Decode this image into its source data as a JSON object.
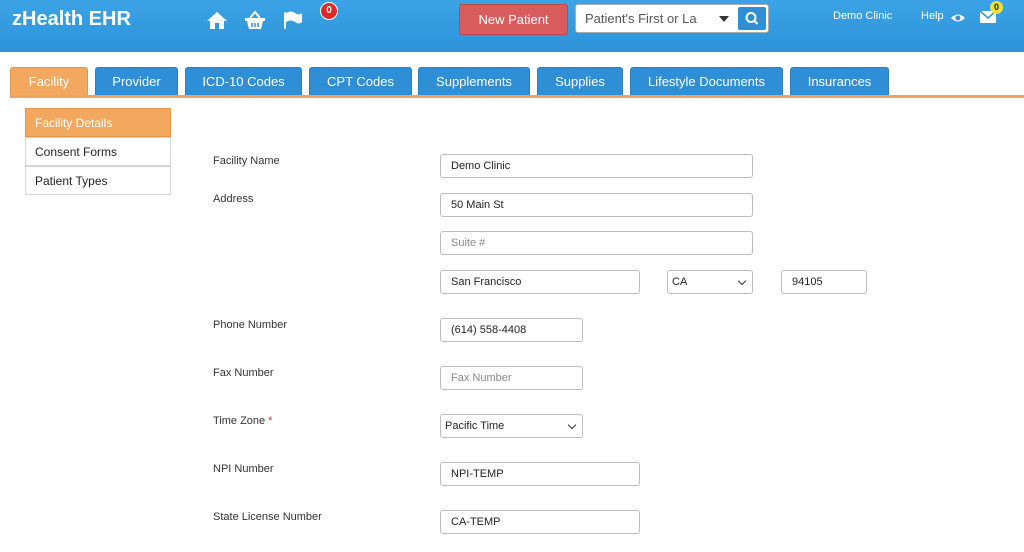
{
  "app": {
    "brand": "zHealth EHR",
    "notification_count": "0",
    "new_patient_label": "New Patient",
    "search_placeholder": "Patient's First or La",
    "clinic_name": "Demo Clinic",
    "help_label": "Help",
    "mail_count": "0",
    "icons": [
      "home-icon",
      "basket-icon",
      "flag-icon",
      "search-icon",
      "eye-icon",
      "envelope-icon"
    ]
  },
  "tabs": [
    {
      "label": "Facility",
      "active": true
    },
    {
      "label": "Provider"
    },
    {
      "label": "ICD-10 Codes"
    },
    {
      "label": "CPT Codes"
    },
    {
      "label": "Supplements"
    },
    {
      "label": "Supplies"
    },
    {
      "label": "Lifestyle Documents"
    },
    {
      "label": "Insurances"
    }
  ],
  "sidebar": {
    "items": [
      {
        "label": "Facility Details",
        "active": true
      },
      {
        "label": "Consent Forms"
      },
      {
        "label": "Patient Types"
      }
    ]
  },
  "form": {
    "facility_name": {
      "label": "Facility Name",
      "value": "Demo Clinic"
    },
    "address": {
      "label": "Address",
      "line1": "50 Main St",
      "suite_placeholder": "Suite #",
      "city": "San Francisco",
      "state": "CA",
      "zip": "94105"
    },
    "phone": {
      "label": "Phone Number",
      "value": "(614) 558-4408"
    },
    "fax": {
      "label": "Fax Number",
      "placeholder": "Fax Number"
    },
    "time_zone": {
      "label": "Time Zone",
      "required_mark": "*",
      "value": "Pacific Time"
    },
    "npi": {
      "label": "NPI Number",
      "value": "NPI-TEMP"
    },
    "state_license": {
      "label": "State License Number",
      "value": "CA-TEMP"
    }
  },
  "colors": {
    "topbar": "#2e93d8",
    "tab": "#2f8fd6",
    "active": "#f3a860",
    "new_patient": "#d85c5c"
  }
}
